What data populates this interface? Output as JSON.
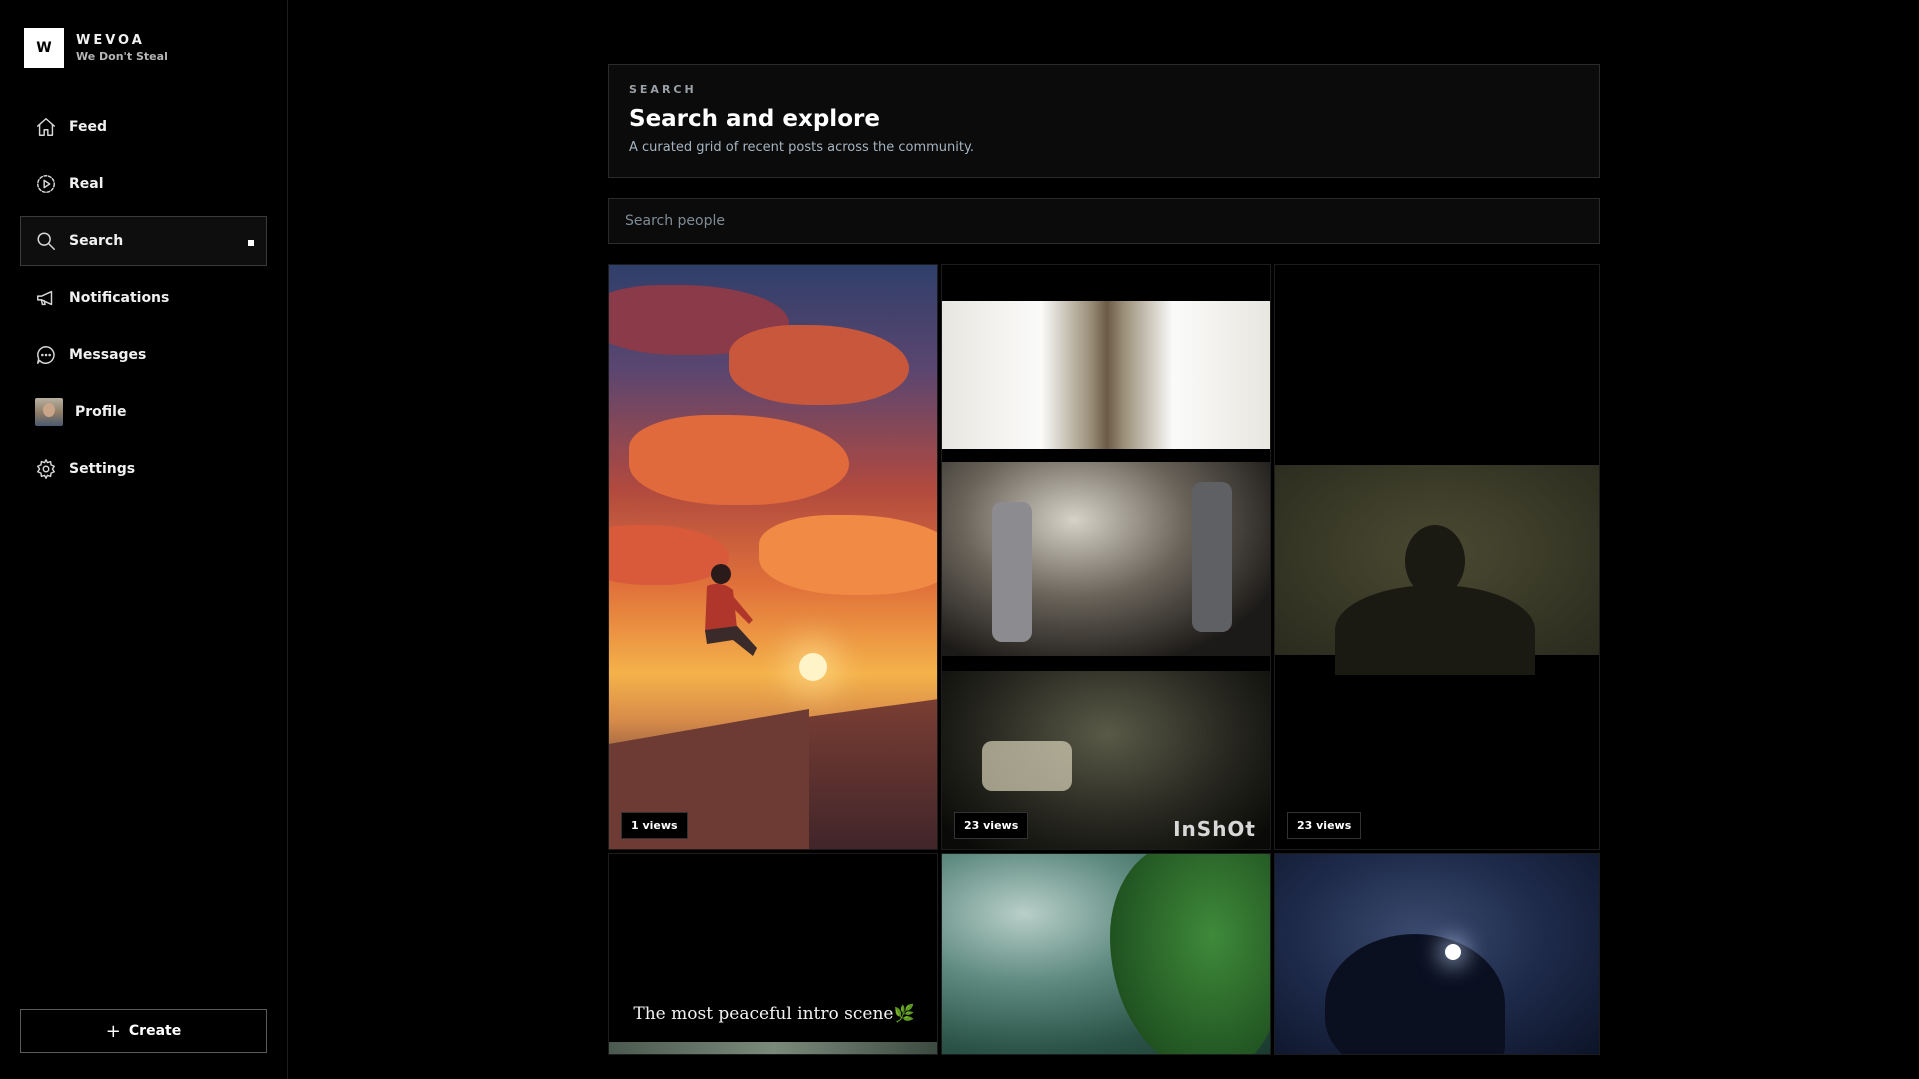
{
  "brand": {
    "logo_letter": "W",
    "name": "WEVOA",
    "tagline": "We Don't Steal"
  },
  "nav": {
    "items": [
      {
        "label": "Feed",
        "icon": "home-icon"
      },
      {
        "label": "Real",
        "icon": "play-circle-icon"
      },
      {
        "label": "Search",
        "icon": "search-icon",
        "active": true
      },
      {
        "label": "Notifications",
        "icon": "megaphone-icon"
      },
      {
        "label": "Messages",
        "icon": "chat-bubble-icon"
      },
      {
        "label": "Profile",
        "icon": "avatar"
      },
      {
        "label": "Settings",
        "icon": "gear-icon"
      }
    ]
  },
  "create": {
    "label": "Create",
    "icon": "plus-icon"
  },
  "header": {
    "eyebrow": "SEARCH",
    "title": "Search and explore",
    "subtitle": "A curated grid of recent posts across the community."
  },
  "search": {
    "placeholder": "Search people",
    "value": ""
  },
  "grid": {
    "tiles": [
      {
        "views": "1 views",
        "scene": "sunset-rooftop"
      },
      {
        "views": "23 views",
        "scene": "anime-train",
        "watermark": "InShOt"
      },
      {
        "views": "23 views",
        "scene": "shadow-silhouette"
      },
      {
        "caption": "The most peaceful intro scene🌿",
        "scene": "dark-caption"
      },
      {
        "scene": "green-trees"
      },
      {
        "scene": "moon-night"
      }
    ]
  },
  "colors": {
    "background": "#000000",
    "accent": "#ffffff",
    "border": "#2b2b2b"
  }
}
